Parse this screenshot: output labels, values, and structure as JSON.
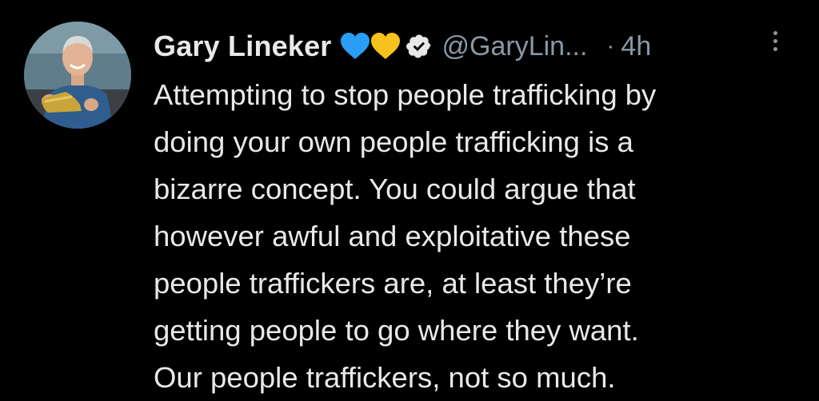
{
  "tweet": {
    "author_name": "Gary Lineker",
    "handle": "@GaryLin...",
    "separator": "·",
    "time": "4h",
    "verified_icon": "verified-badge-icon",
    "emoji": [
      "blue-heart-icon",
      "yellow-heart-icon"
    ],
    "colors": {
      "blue_heart": "#2a9df4",
      "yellow_heart": "#f7c21d",
      "secondary_text": "#8b98a5",
      "primary_text": "#e7e9ea",
      "background": "#000000"
    },
    "text_lines": [
      "Attempting to stop people trafficking by",
      "doing your own people trafficking is a",
      "bizarre concept. You could argue that",
      "however awful and exploitative these",
      "people traffickers are, at least they’re",
      "getting people to go where they want.",
      "Our people traffickers, not so much."
    ]
  }
}
